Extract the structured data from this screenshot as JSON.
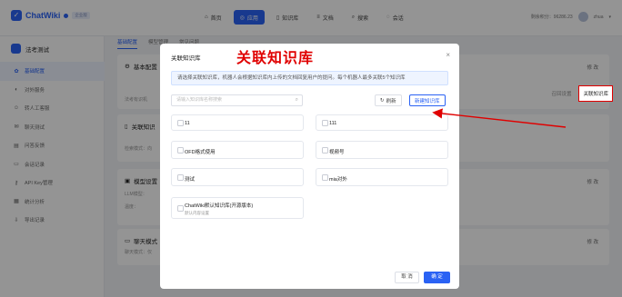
{
  "app": {
    "name": "ChatWiki",
    "badge": "企业版"
  },
  "nav": [
    {
      "label": "首页",
      "icon": "home-icon",
      "glyph": "⌂",
      "active": false
    },
    {
      "label": "应用",
      "icon": "app-icon",
      "glyph": "◎",
      "active": true
    },
    {
      "label": "知识库",
      "icon": "book-icon",
      "glyph": "▯",
      "active": false
    },
    {
      "label": "文档",
      "icon": "doc-icon",
      "glyph": "≡",
      "active": false
    },
    {
      "label": "搜索",
      "icon": "search-icon",
      "glyph": "⌕",
      "active": false
    },
    {
      "label": "会话",
      "icon": "chat-icon",
      "glyph": "◌",
      "active": false
    }
  ],
  "user": {
    "info": "剩余积分：96286.23",
    "name": "zhua"
  },
  "sidebar": {
    "title": "法考测试",
    "items": [
      {
        "label": "基础配置",
        "icon": "settings-icon",
        "glyph": "✿",
        "active": true
      },
      {
        "label": "对外服务",
        "icon": "service-icon",
        "glyph": "◐",
        "active": false
      },
      {
        "label": "转人工客服",
        "icon": "agent-icon",
        "glyph": "☺",
        "active": false
      },
      {
        "label": "聊天测试",
        "icon": "test-icon",
        "glyph": "✉",
        "active": false
      },
      {
        "label": "问答反馈",
        "icon": "feedback-icon",
        "glyph": "▤",
        "active": false
      },
      {
        "label": "会话记录",
        "icon": "record-icon",
        "glyph": "▭",
        "active": false
      },
      {
        "label": "API Key管理",
        "icon": "key-icon",
        "glyph": "⚷",
        "active": false
      },
      {
        "label": "统计分析",
        "icon": "stats-icon",
        "glyph": "▦",
        "active": false
      },
      {
        "label": "导出记录",
        "icon": "export-icon",
        "glyph": "⇩",
        "active": false
      }
    ]
  },
  "tabs": [
    "基础配置",
    "模型管理",
    "常见问题"
  ],
  "cards": {
    "basic": {
      "title": "基本配置",
      "desc": "法考有识机",
      "edit": "修 改"
    },
    "kb": {
      "title": "关联知识",
      "desc": "检索模式：向",
      "recall": "召回设置",
      "link": "关联知识库"
    },
    "model": {
      "title": "模型设置",
      "desc1": "LLM模型：",
      "desc2": "温度：",
      "edit": "修 改"
    },
    "chat": {
      "title": "聊天模式",
      "desc": "聊天模式：仅",
      "edit": "修 改"
    }
  },
  "modal": {
    "title": "关联知识库",
    "notice": "请选择关联知识库，机器人会根据知识库内上传的文档回复用户的提问。每个机器人最多关联5个知识库",
    "search_placeholder": "请输入知识库名称搜索",
    "refresh": "刷新",
    "new_kb": "新建知识库",
    "kbs": [
      {
        "name": "11",
        "sub": ""
      },
      {
        "name": "111",
        "sub": ""
      },
      {
        "name": "OFD格式使用",
        "sub": ""
      },
      {
        "name": "视频号",
        "sub": ""
      },
      {
        "name": "测试",
        "sub": ""
      },
      {
        "name": "mia对外",
        "sub": ""
      },
      {
        "name": "ChatWiki默认知识库(开源版本)",
        "sub": "默认内容设置"
      }
    ],
    "cancel": "取 消",
    "confirm": "确 定"
  },
  "annotation": "关联知识库",
  "colors": {
    "accent": "#2a62f4",
    "annotation": "#e00000"
  }
}
